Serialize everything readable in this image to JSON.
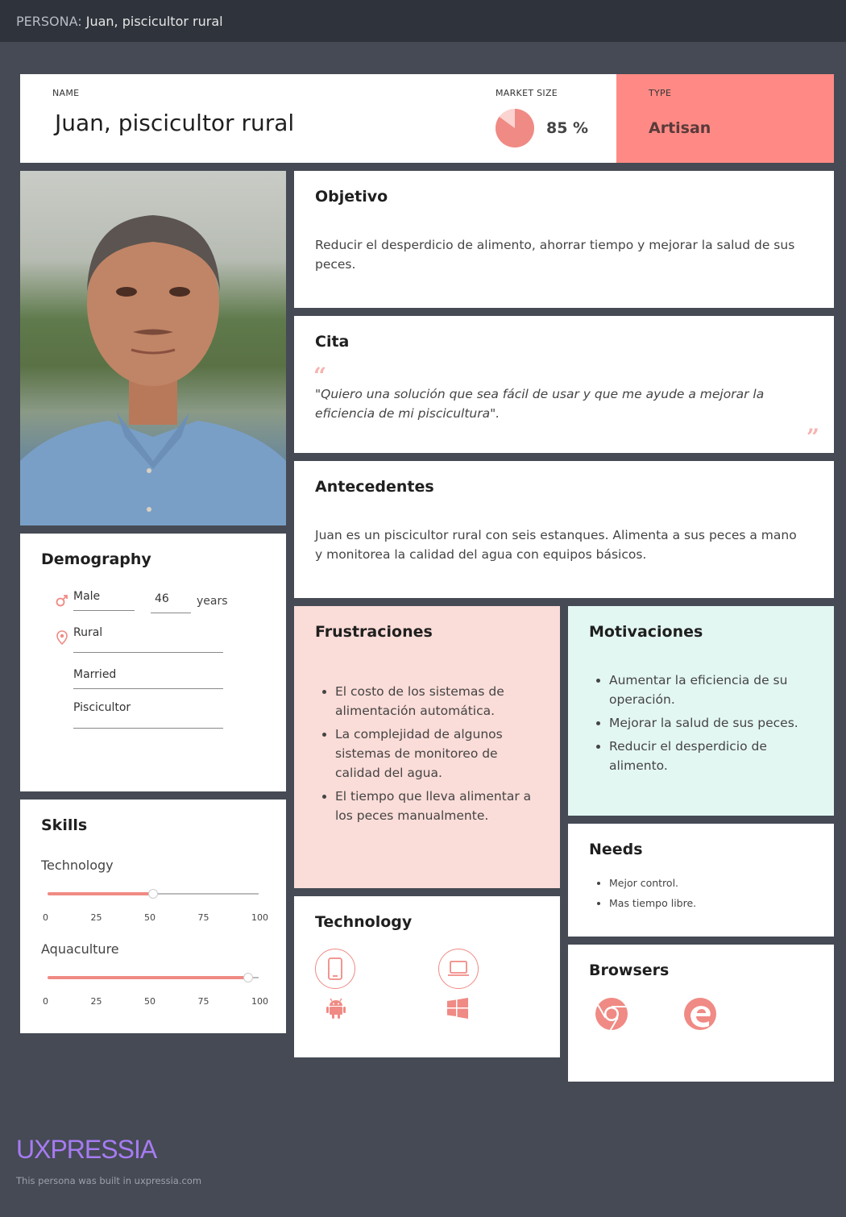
{
  "topbar": {
    "prefix": "PERSONA:",
    "title": "Juan, piscicultor rural"
  },
  "header": {
    "name_label": "NAME",
    "name": "Juan, piscicultor rural",
    "market_label": "MARKET SIZE",
    "market_percent": 85,
    "market_text": "85 %",
    "type_label": "TYPE",
    "type_value": "Artisan"
  },
  "objetivo": {
    "title": "Objetivo",
    "text": "Reducir el desperdicio de alimento, ahorrar tiempo y mejorar la salud de sus peces."
  },
  "cita": {
    "title": "Cita",
    "text": "\"Quiero una solución que sea fácil de usar y que me ayude a mejorar la eficiencia de mi piscicultura\"."
  },
  "antecedentes": {
    "title": "Antecedentes",
    "text": "Juan es un piscicultor rural con seis estanques. Alimenta a sus peces a mano y monitorea la calidad del agua con equipos básicos."
  },
  "demography": {
    "title": "Demography",
    "gender": "Male",
    "age": "46",
    "age_unit": "years",
    "location": "Rural",
    "marital": "Married",
    "occupation": "Piscicultor"
  },
  "skills": {
    "title": "Skills",
    "ticks": [
      "0",
      "25",
      "50",
      "75",
      "100"
    ],
    "items": [
      {
        "label": "Technology",
        "value": 50
      },
      {
        "label": "Aquaculture",
        "value": 95
      }
    ]
  },
  "frustraciones": {
    "title": "Frustraciones",
    "items": [
      "El costo de los sistemas de alimentación automática.",
      "La complejidad de algunos sistemas de monitoreo de calidad del agua.",
      "El tiempo que lleva alimentar a los peces manualmente."
    ]
  },
  "motivaciones": {
    "title": "Motivaciones",
    "items": [
      "Aumentar la eficiencia de su operación.",
      "Mejorar la salud de sus peces.",
      "Reducir el desperdicio de alimento."
    ]
  },
  "needs": {
    "title": "Needs",
    "items": [
      "Mejor control.",
      "Mas tiempo libre."
    ]
  },
  "technology": {
    "title": "Technology",
    "icons": [
      "smartphone-icon",
      "laptop-icon",
      "android-icon",
      "windows-icon"
    ]
  },
  "browsers": {
    "title": "Browsers",
    "icons": [
      "chrome-icon",
      "edge-icon"
    ]
  },
  "footer": {
    "brand": "UXPRESSIA",
    "tagline": "This persona was built in uxpressia.com"
  },
  "colors": {
    "accent": "#f08a84",
    "type_bg": "#ff8a85",
    "frustr_bg": "#fadcd8",
    "motiv_bg": "#e3f7f2",
    "background": "#454a54",
    "topbar": "#2f333c",
    "brand": "#a77bf3"
  }
}
